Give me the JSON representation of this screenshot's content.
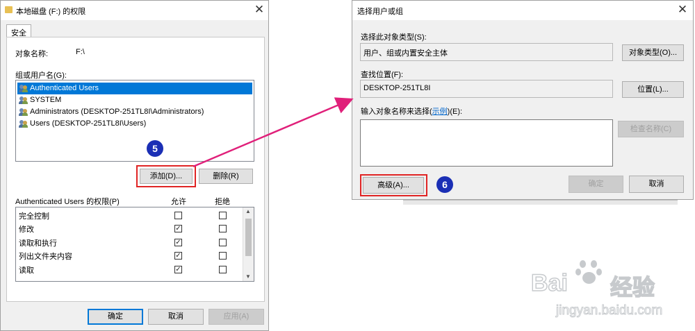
{
  "left_dialog": {
    "title": "本地磁盘 (F:) 的权限",
    "tab": "安全",
    "object_name_label": "对象名称:",
    "object_name_value": "F:\\",
    "group_label": "组或用户名(G):",
    "users": [
      "Authenticated Users",
      "SYSTEM",
      "Administrators (DESKTOP-251TL8I\\Administrators)",
      "Users (DESKTOP-251TL8I\\Users)"
    ],
    "add_button": "添加(D)...",
    "remove_button": "删除(R)",
    "perm_label": "Authenticated Users 的权限(P)",
    "allow_header": "允许",
    "deny_header": "拒绝",
    "permissions": [
      {
        "name": "完全控制",
        "allow": false,
        "deny": false
      },
      {
        "name": "修改",
        "allow": true,
        "deny": false
      },
      {
        "name": "读取和执行",
        "allow": true,
        "deny": false
      },
      {
        "name": "列出文件夹内容",
        "allow": true,
        "deny": false
      },
      {
        "name": "读取",
        "allow": true,
        "deny": false
      }
    ],
    "ok_button": "确定",
    "cancel_button": "取消",
    "apply_button": "应用(A)",
    "badge": "5"
  },
  "right_dialog": {
    "title": "选择用户或组",
    "object_type_label": "选择此对象类型(S):",
    "object_type_value": "用户、组或内置安全主体",
    "object_type_button": "对象类型(O)...",
    "location_label": "查找位置(F):",
    "location_value": "DESKTOP-251TL8I",
    "location_button": "位置(L)...",
    "enter_label_prefix": "输入对象名称来选择(",
    "enter_label_link": "示例",
    "enter_label_suffix": ")(E):",
    "check_names_button": "检查名称(C)",
    "advanced_button": "高级(A)...",
    "ok_button": "确定",
    "cancel_button": "取消",
    "badge": "6"
  },
  "watermark": {
    "brand": "Bai",
    "brand2": "经验",
    "url": "jingyan.baidu.com"
  },
  "colors": {
    "selection": "#0078d7",
    "highlight_box": "#e02424",
    "badge": "#1b2fb5",
    "arrow": "#e0207a"
  }
}
